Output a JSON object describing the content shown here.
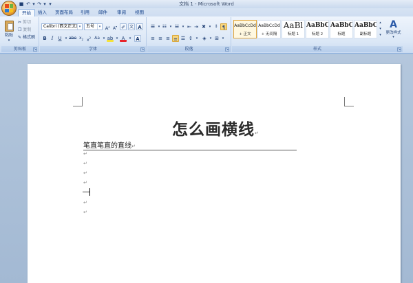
{
  "window": {
    "title": "文档 1 - Microsoft Word"
  },
  "tabs": [
    {
      "label": "开始",
      "active": true
    },
    {
      "label": "插入"
    },
    {
      "label": "页面布局"
    },
    {
      "label": "引用"
    },
    {
      "label": "邮件"
    },
    {
      "label": "审阅"
    },
    {
      "label": "视图"
    }
  ],
  "clipboard": {
    "paste": "粘贴",
    "cut": "剪切",
    "copy": "复制",
    "format_painter": "格式刷",
    "label": "剪贴板"
  },
  "font": {
    "name": "Calibri (西文正文)",
    "size": "五号",
    "label": "字体"
  },
  "paragraph": {
    "label": "段落"
  },
  "styles": {
    "items": [
      {
        "sample": "AaBbCcDd",
        "name": "+ 正文",
        "selected": true
      },
      {
        "sample": "AaBbCcDd",
        "name": "+ 无间隔"
      },
      {
        "sample": "AaBl",
        "name": "标题 1"
      },
      {
        "sample": "AaBbC",
        "name": "标题 2"
      },
      {
        "sample": "AaBbC",
        "name": "标题"
      },
      {
        "sample": "AaBbC",
        "name": "副标题"
      }
    ],
    "change_styles": "更改样式",
    "label": "样式"
  },
  "document": {
    "heading": "怎么画横线",
    "line_text": "笔直笔直的直线",
    "return_mark": "↵"
  }
}
